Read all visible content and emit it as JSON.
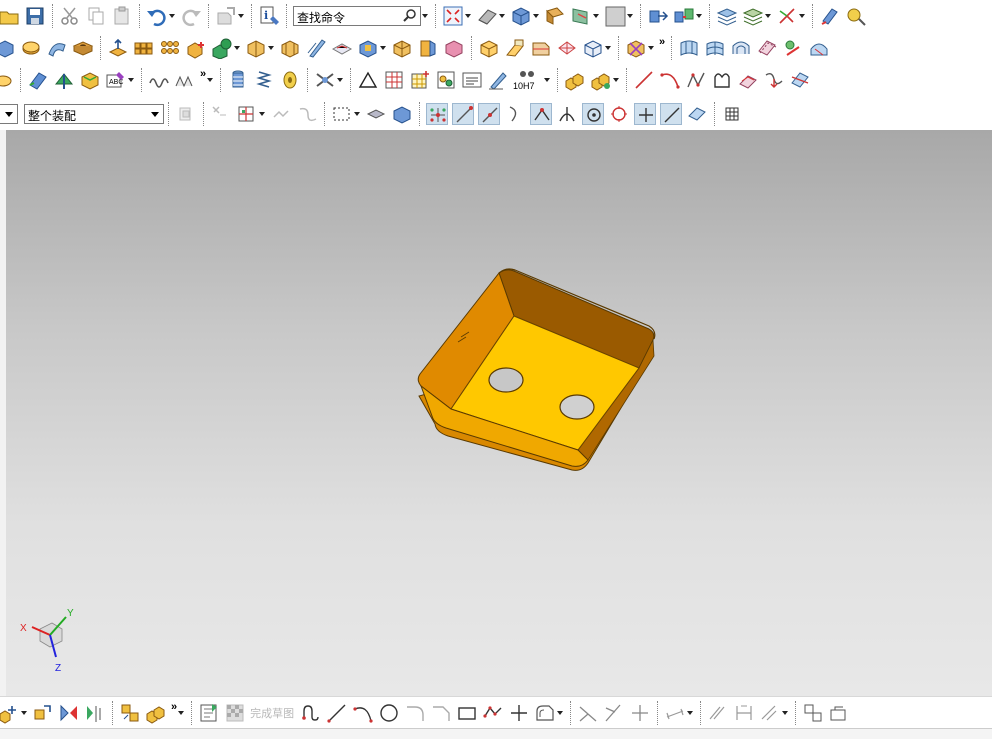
{
  "toolbar": {
    "search": {
      "placeholder": "查找命令"
    },
    "assembly_filter": {
      "value": "整个装配"
    },
    "tolerance_label": "10H7"
  },
  "bottom_toolbar": {
    "finish_sketch_label": "完成草图"
  },
  "triad": {
    "x_label": "X",
    "y_label": "Y",
    "z_label": "Z"
  },
  "colors": {
    "part_face": "#ffc800",
    "part_shadow": "#d98800",
    "part_edge": "#5a3a00",
    "background_top": "#a8a8a8",
    "background_bottom": "#e8e8e8"
  }
}
